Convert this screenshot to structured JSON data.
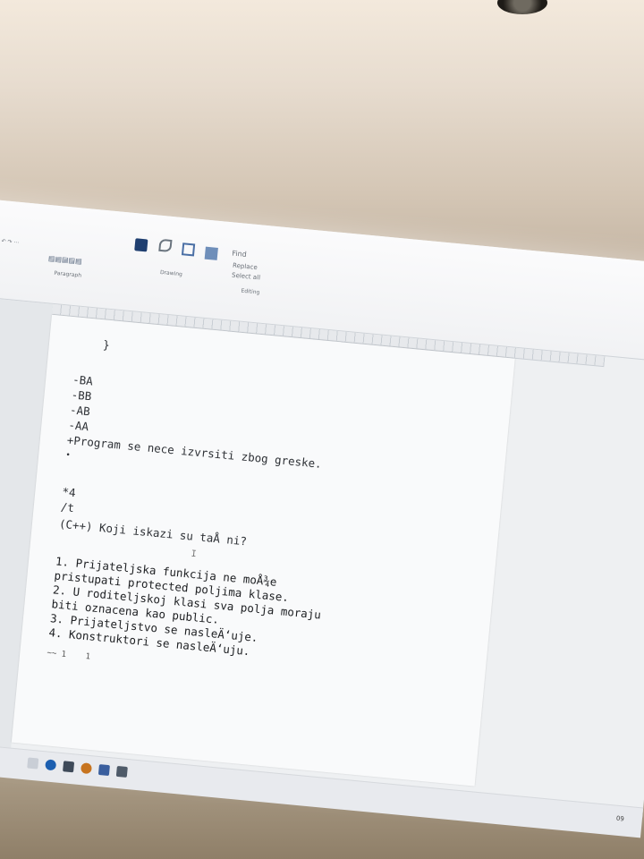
{
  "ribbon": {
    "groups": {
      "paragraph_label": "Paragraph",
      "drawing_label": "Drawing",
      "editing_label": "Editing",
      "find_label": "Find",
      "replace_label": "Replace",
      "select_label": "Select all"
    }
  },
  "document": {
    "brace": "}",
    "options": [
      "-BA",
      "-BB",
      "-AB",
      "-AA"
    ],
    "error_option": "+Program se nece izvrsiti zbog greske.",
    "question_no": "*4",
    "slash": "/t",
    "question": "(C++) Koji iskazi su taÅ ni?",
    "cursor": "I",
    "statements": [
      "1. Prijateljska funkcija ne moÅ¾e",
      "pristupati protected poljima klase.",
      "2. U roditeljskoj klasi sva polja moraju",
      "biti oznacena kao public.",
      "3. Prijateljstvo se nasleÄ‘uje.",
      "4. Konstruktori se nasleÄ‘uju."
    ],
    "footer_fragment": "~~ 1    1"
  },
  "taskbar": {
    "clock": "09"
  }
}
